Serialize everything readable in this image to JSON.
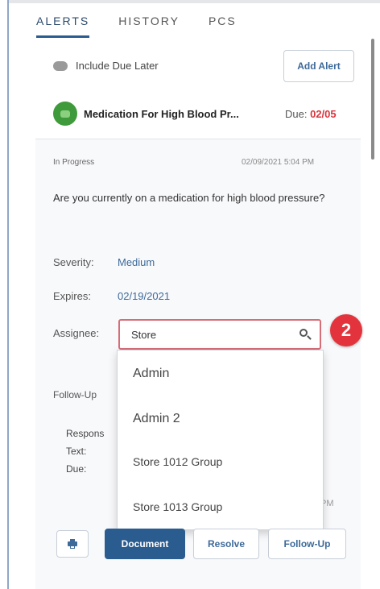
{
  "tabs": [
    "ALERTS",
    "HISTORY",
    "PCS"
  ],
  "include_due_later_label": "Include Due Later",
  "add_alert_label": "Add Alert",
  "alert": {
    "title": "Medication For High Blood Pr...",
    "due_label": "Due:",
    "due_date": "02/05"
  },
  "detail": {
    "status": "In Progress",
    "timestamp": "02/09/2021 5:04 PM",
    "question": "Are you currently on a medication for high blood pressure?",
    "severity_label": "Severity:",
    "severity_value": "Medium",
    "expires_label": "Expires:",
    "expires_value": "02/19/2021",
    "assignee_label": "Assignee:",
    "assignee_search_value": "Store",
    "followup_label": "Follow-Up",
    "response_label": "Respons",
    "text_label": "Text:",
    "due_label": "Due:",
    "pm_fragment": "PM"
  },
  "dropdown_options": [
    "Admin",
    "Admin 2",
    "Store 1012 Group",
    "Store 1013 Group"
  ],
  "step_badge": "2",
  "actions": {
    "document": "Document",
    "resolve": "Resolve",
    "followup": "Follow-Up"
  },
  "colors": {
    "accent": "#2b5c8f",
    "link": "#3e6a99",
    "due_red": "#d9343d",
    "badge_red": "#e3343d",
    "alert_icon_green": "#3f9a3b"
  }
}
